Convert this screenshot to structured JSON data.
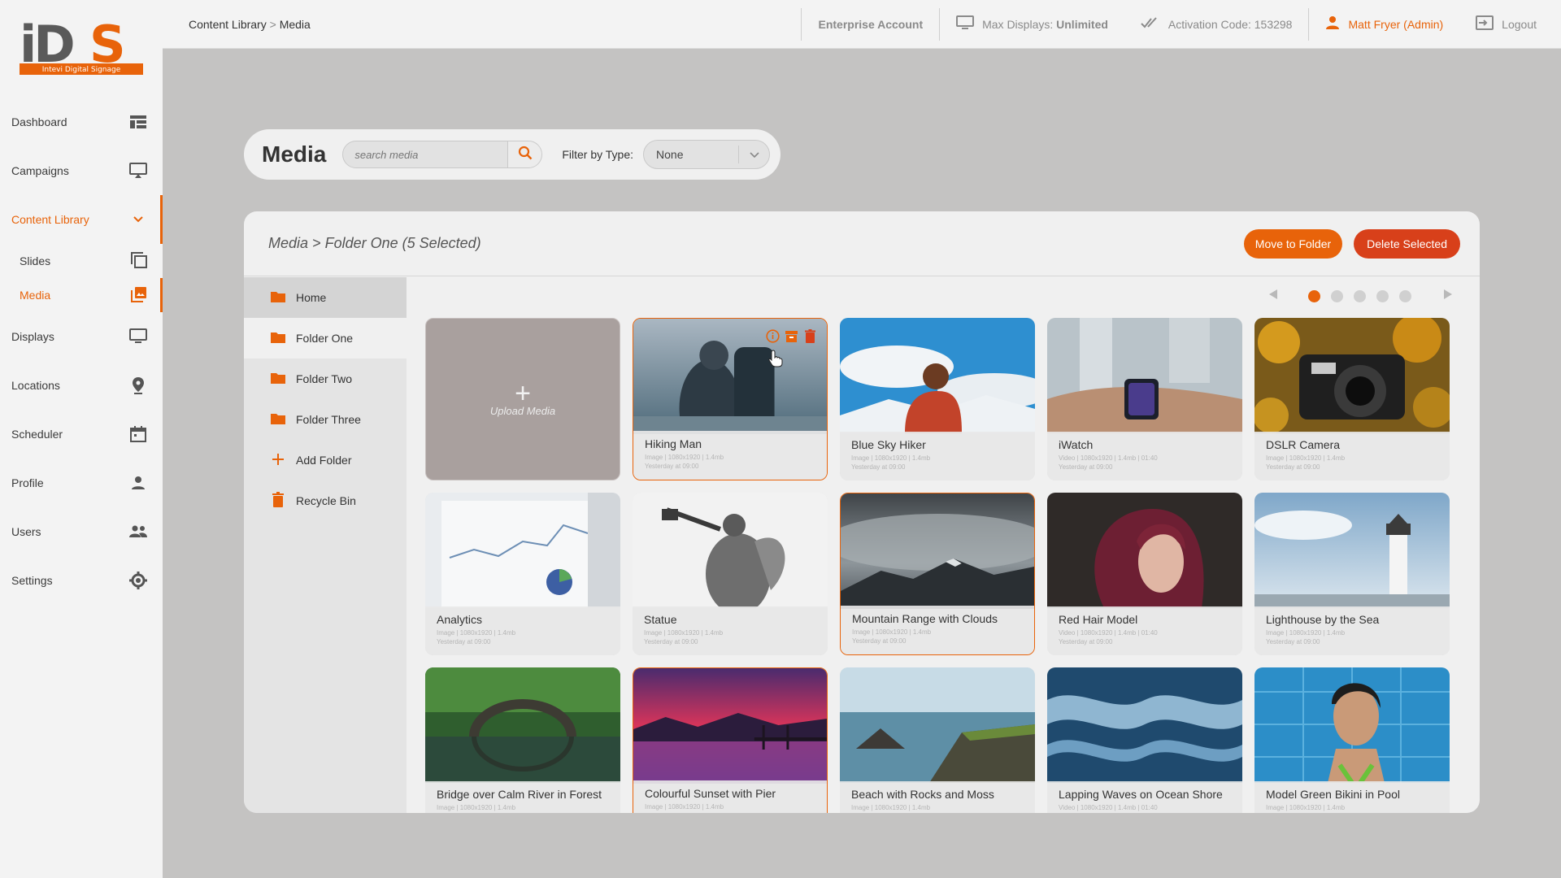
{
  "app": {
    "logo_text": "iDS",
    "logo_subtitle": "Intevi Digital Signage"
  },
  "breadcrumb": {
    "parent": "Content Library",
    "separator": ">",
    "current": "Media"
  },
  "topbar": {
    "account": "Enterprise Account",
    "max_displays_label": "Max Displays:",
    "max_displays_value": "Unlimited",
    "activation": "Activation Code: 153298",
    "user": "Matt Fryer (Admin)",
    "logout": "Logout"
  },
  "sidebar": {
    "items": [
      {
        "label": "Dashboard",
        "icon": "dashboard-icon"
      },
      {
        "label": "Campaigns",
        "icon": "campaigns-icon"
      },
      {
        "label": "Content Library",
        "icon": "chevron-down-icon"
      },
      {
        "label": "Slides",
        "icon": "slides-icon"
      },
      {
        "label": "Media",
        "icon": "media-icon"
      },
      {
        "label": "Displays",
        "icon": "monitor-icon"
      },
      {
        "label": "Locations",
        "icon": "location-pin-icon"
      },
      {
        "label": "Scheduler",
        "icon": "calendar-icon"
      },
      {
        "label": "Profile",
        "icon": "person-icon"
      },
      {
        "label": "Users",
        "icon": "users-icon"
      },
      {
        "label": "Settings",
        "icon": "gear-icon"
      }
    ]
  },
  "search": {
    "title": "Media",
    "placeholder": "search media",
    "filter_label": "Filter by Type:",
    "filter_value": "None"
  },
  "panel": {
    "breadcrumb_home": "Media",
    "breadcrumb_sep": ">",
    "breadcrumb_folder": "Folder One (5 Selected)",
    "move_button": "Move to Folder",
    "delete_button": "Delete Selected"
  },
  "folders": [
    {
      "label": "Home",
      "icon": "folder-icon"
    },
    {
      "label": "Folder One",
      "icon": "folder-icon"
    },
    {
      "label": "Folder Two",
      "icon": "folder-icon"
    },
    {
      "label": "Folder Three",
      "icon": "folder-icon"
    },
    {
      "label": "Add Folder",
      "icon": "plus-icon"
    },
    {
      "label": "Recycle Bin",
      "icon": "trash-icon"
    }
  ],
  "pagination": {
    "pages": 5,
    "current": 1
  },
  "upload": {
    "label": "Upload Media"
  },
  "media": [
    {
      "name": "Hiking Man",
      "meta1": "Image | 1080x1920 | 1.4mb",
      "meta2": "Yesterday at 09:00",
      "selected": true
    },
    {
      "name": "Blue Sky Hiker",
      "meta1": "Image | 1080x1920 | 1.4mb",
      "meta2": "Yesterday at 09:00",
      "selected": false
    },
    {
      "name": "iWatch",
      "meta1": "Video | 1080x1920 | 1.4mb | 01:40",
      "meta2": "Yesterday at 09:00",
      "selected": false
    },
    {
      "name": "DSLR Camera",
      "meta1": "Image | 1080x1920 | 1.4mb",
      "meta2": "Yesterday at 09:00",
      "selected": false
    },
    {
      "name": "Analytics",
      "meta1": "Image | 1080x1920 | 1.4mb",
      "meta2": "Yesterday at 09:00",
      "selected": false
    },
    {
      "name": "Statue",
      "meta1": "Image | 1080x1920 | 1.4mb",
      "meta2": "Yesterday at 09:00",
      "selected": false
    },
    {
      "name": "Mountain Range with Clouds",
      "meta1": "Image | 1080x1920 | 1.4mb",
      "meta2": "Yesterday at 09:00",
      "selected": true
    },
    {
      "name": "Red Hair Model",
      "meta1": "Video | 1080x1920 | 1.4mb | 01:40",
      "meta2": "Yesterday at 09:00",
      "selected": false
    },
    {
      "name": "Lighthouse by the Sea",
      "meta1": "Image | 1080x1920 | 1.4mb",
      "meta2": "Yesterday at 09:00",
      "selected": false
    },
    {
      "name": "Bridge over Calm River in Forest",
      "meta1": "Image | 1080x1920 | 1.4mb",
      "meta2": "",
      "selected": false
    },
    {
      "name": "Colourful Sunset with Pier",
      "meta1": "Image | 1080x1920 | 1.4mb",
      "meta2": "",
      "selected": true
    },
    {
      "name": "Beach with Rocks and Moss",
      "meta1": "Image | 1080x1920 | 1.4mb",
      "meta2": "",
      "selected": false
    },
    {
      "name": "Lapping Waves on Ocean Shore",
      "meta1": "Video | 1080x1920 | 1.4mb | 01:40",
      "meta2": "",
      "selected": false
    },
    {
      "name": "Model Green Bikini in Pool",
      "meta1": "Image | 1080x1920 | 1.4mb",
      "meta2": "",
      "selected": false
    }
  ],
  "colors": {
    "accent": "#e8630a",
    "danger": "#d8401a",
    "sidebar_bg": "#f3f3f3",
    "page_bg": "#c4c3c2"
  }
}
